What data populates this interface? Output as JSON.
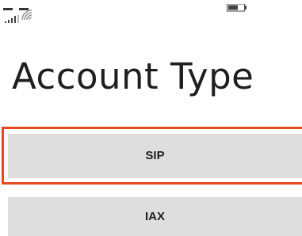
{
  "status_bar": {
    "signal_icon": "cellular-signal-icon",
    "wifi_icon": "wifi-icon",
    "battery_icon": "battery-icon"
  },
  "page": {
    "title": "Account Type"
  },
  "account_types": [
    {
      "label": "SIP",
      "focused": true
    },
    {
      "label": "IAX",
      "focused": false
    }
  ],
  "colors": {
    "background": "#ffffff",
    "button_background": "#dedede",
    "focus_ring": "#e8471d",
    "text": "#1f1f1f"
  }
}
